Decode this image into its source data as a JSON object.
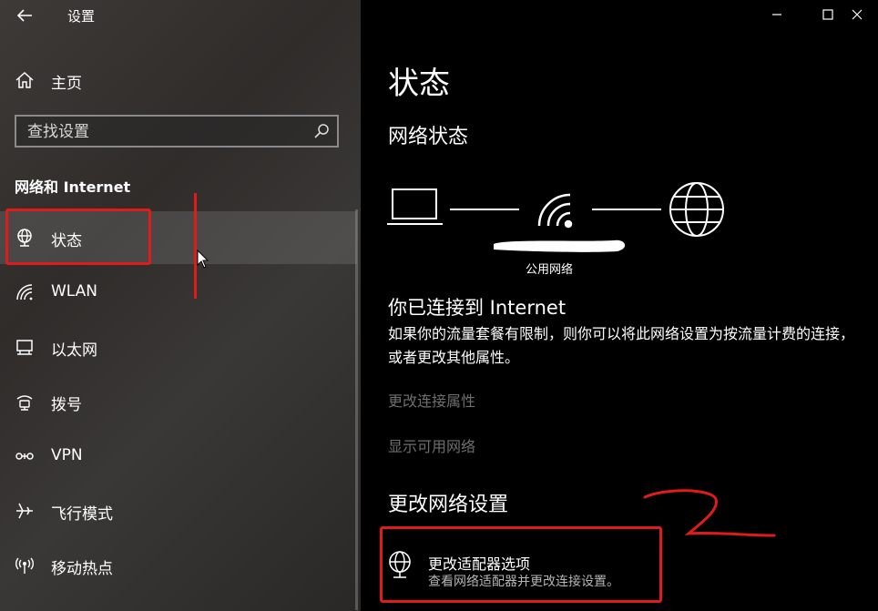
{
  "window": {
    "title": "设置",
    "controls": [
      "minimize",
      "maximize",
      "close"
    ]
  },
  "sidebar": {
    "home_label": "主页",
    "search": {
      "placeholder": "查找设置",
      "value": ""
    },
    "section_heading": "网络和 Internet",
    "items": [
      {
        "label": "状态",
        "icon": "globe-network-icon",
        "selected": true
      },
      {
        "label": "WLAN",
        "icon": "wifi-icon",
        "selected": false
      },
      {
        "label": "以太网",
        "icon": "ethernet-icon",
        "selected": false
      },
      {
        "label": "拨号",
        "icon": "dialup-icon",
        "selected": false
      },
      {
        "label": "VPN",
        "icon": "vpn-icon",
        "selected": false
      },
      {
        "label": "飞行模式",
        "icon": "airplane-icon",
        "selected": false
      },
      {
        "label": "移动热点",
        "icon": "hotspot-icon",
        "selected": false
      }
    ]
  },
  "main": {
    "page_title": "状态",
    "network_status_heading": "网络状态",
    "network_label": "公用网络",
    "connected_heading": "你已连接到 Internet",
    "connected_desc": "如果你的流量套餐有限制，则你可以将此网络设置为按流量计费的连接，或者更改其他属性。",
    "link_change_props": "更改连接属性",
    "link_show_networks": "显示可用网络",
    "change_settings_heading": "更改网络设置",
    "adapter_option": {
      "title": "更改适配器选项",
      "description": "查看网络适配器并更改连接设置。"
    }
  },
  "colors": {
    "annotation_red": "#e01b1b",
    "disabled_link": "#6e6e6e",
    "main_bg": "#000000"
  }
}
